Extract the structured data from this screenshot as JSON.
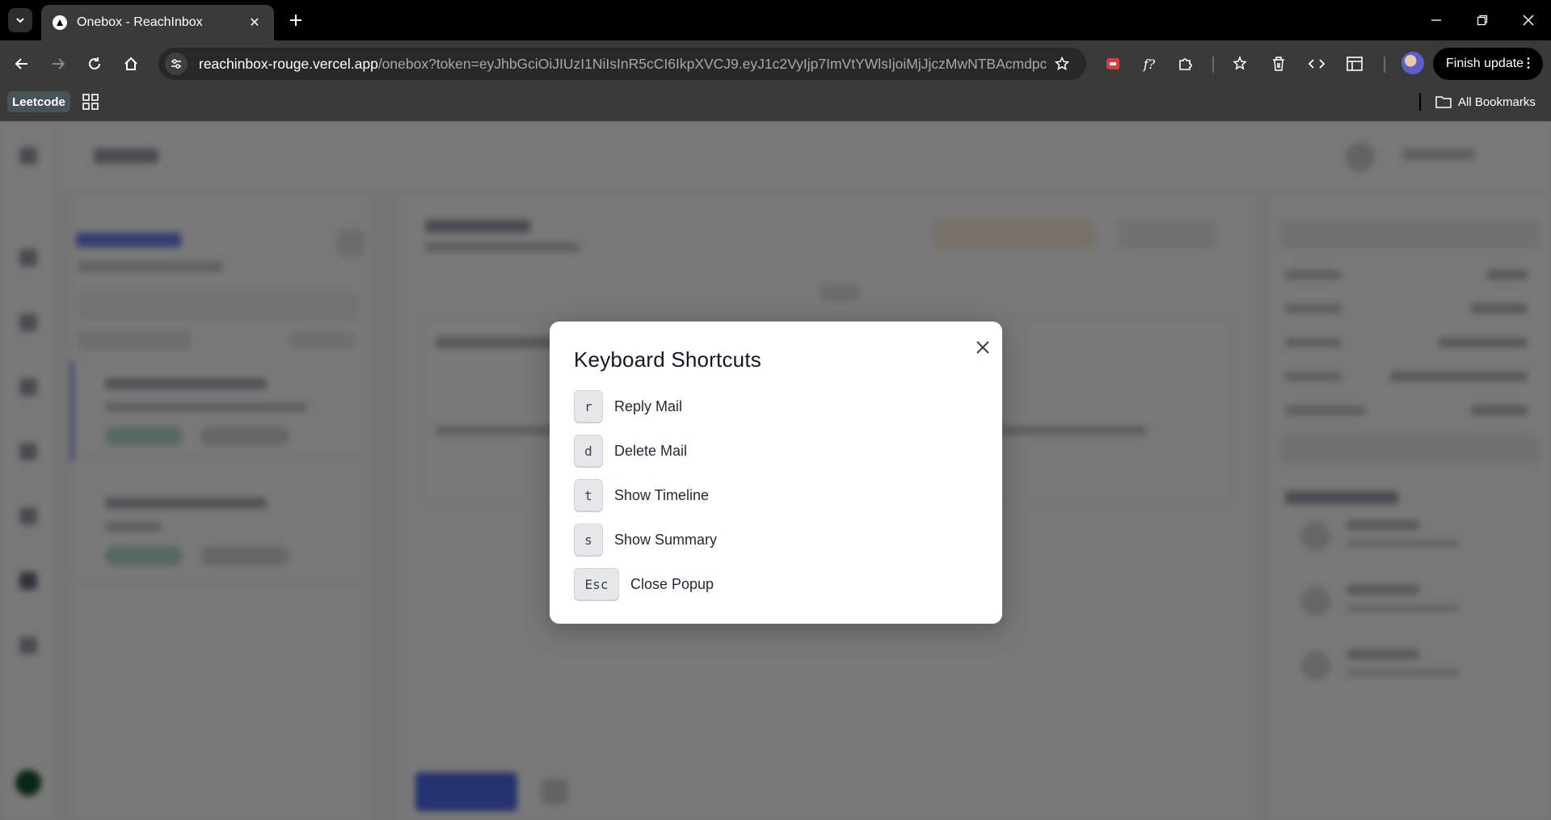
{
  "browser": {
    "tab_title": "Onebox - ReachInbox",
    "url_host": "reachinbox-rouge.vercel.app",
    "url_path": "/onebox?token=eyJhbGciOiJIUzI1NiIsInR5cCI6IkpXVCJ9.eyJ1c2VyIjp7ImVtYWlsIjoiMjJjczMwNTBAcmdpcH...",
    "finish_update_label": "Finish update",
    "bookmark_leetcode": "Leetcode",
    "bookmark_all": "All Bookmarks"
  },
  "modal": {
    "title": "Keyboard Shortcuts",
    "shortcuts": [
      {
        "key": "r",
        "label": "Reply Mail"
      },
      {
        "key": "d",
        "label": "Delete Mail"
      },
      {
        "key": "t",
        "label": "Show Timeline"
      },
      {
        "key": "s",
        "label": "Show Summary"
      },
      {
        "key": "Esc",
        "label": "Close Popup"
      }
    ]
  },
  "colors": {
    "accent": "#4f6bed",
    "overlay": "rgba(0,0,0,0.53)"
  }
}
